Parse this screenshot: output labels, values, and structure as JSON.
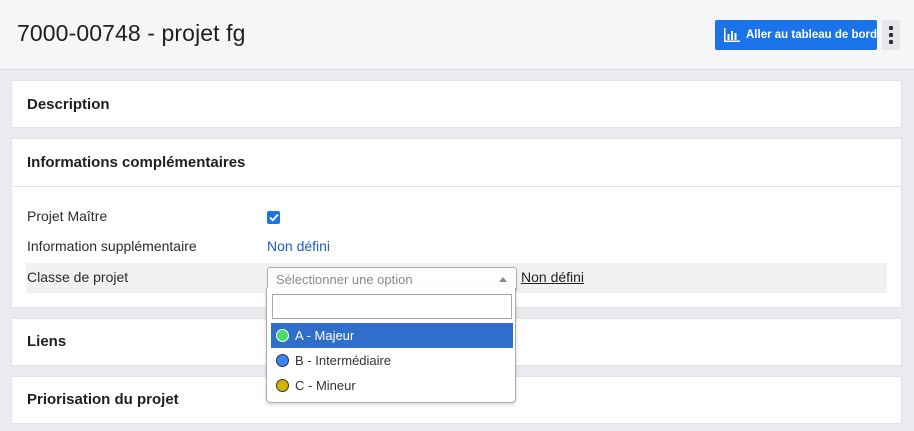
{
  "header": {
    "title": "7000-00748 - projet fg",
    "dashboard_button": "Aller au tableau de bord"
  },
  "panels": {
    "description": "Description",
    "info": "Informations complémentaires",
    "liens": "Liens",
    "priorisation": "Priorisation du projet"
  },
  "fields": {
    "projet_maitre": {
      "label": "Projet Maître",
      "checked": true
    },
    "info_supp": {
      "label": "Information supplémentaire",
      "value": "Non défini"
    },
    "classe": {
      "label": "Classe de projet",
      "placeholder": "Sélectionner une option",
      "value": "Non défini"
    }
  },
  "dropdown": {
    "search_value": "",
    "options": [
      {
        "label": "A - Majeur",
        "color": "#4cd964",
        "active": true
      },
      {
        "label": "B - Intermédiaire",
        "color": "#3b82f6",
        "active": false
      },
      {
        "label": "C - Mineur",
        "color": "#d4b106",
        "active": false
      }
    ]
  },
  "colors": {
    "accent": "#1a73e8",
    "link": "#1a5fc8",
    "selected": "#2f6fcb"
  },
  "icons": {
    "dashboard": "bar-chart-icon",
    "more": "kebab-menu-icon",
    "search": "search-icon",
    "check": "check-icon",
    "arrow": "caret-up-icon"
  }
}
